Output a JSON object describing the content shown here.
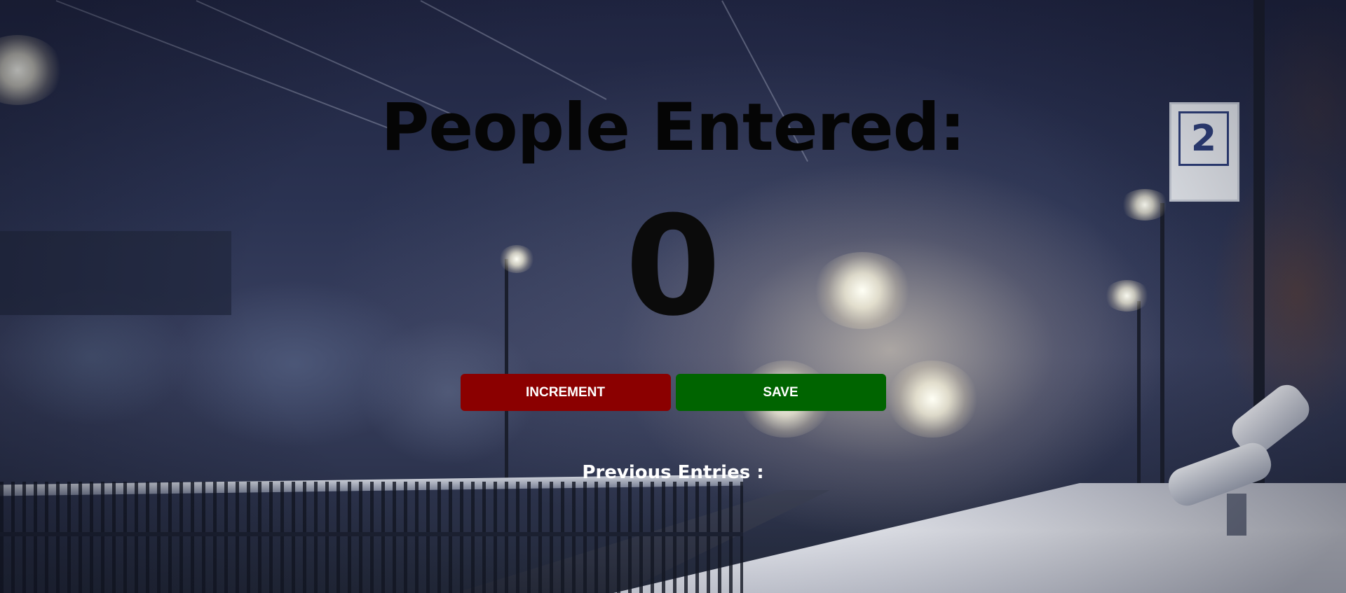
{
  "heading": "People Entered:",
  "counter": "0",
  "buttons": {
    "increment_label": "INCREMENT",
    "save_label": "SAVE"
  },
  "previous_entries_label": "Previous Entries :",
  "background": {
    "platform_sign": "2"
  },
  "colors": {
    "increment_button": "#8b0000",
    "save_button": "#006400",
    "heading_text": "#050505",
    "entries_text": "#ffffff"
  }
}
